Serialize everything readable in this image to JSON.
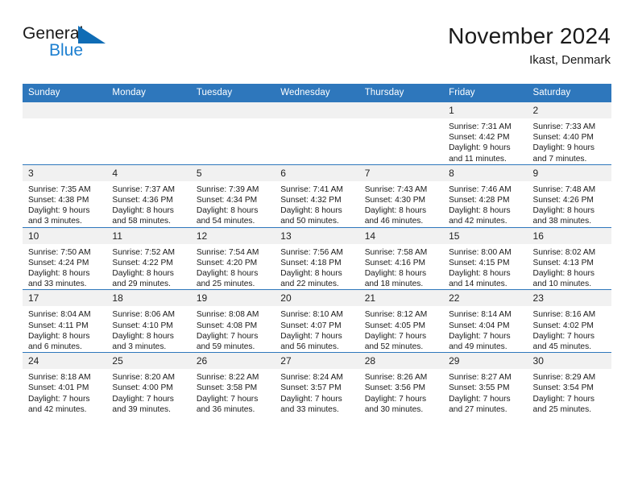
{
  "brand": {
    "name_part1": "General",
    "name_part2": "Blue",
    "triangle_color": "#0f6cb5",
    "blue_color": "#1c7fd0"
  },
  "header": {
    "title": "November 2024",
    "subtitle": "Ikast, Denmark"
  },
  "theme": {
    "header_blue": "#2e77bc",
    "daynum_band": "#f1f1f1",
    "text": "#1a1a1a"
  },
  "weekday_headers": [
    "Sunday",
    "Monday",
    "Tuesday",
    "Wednesday",
    "Thursday",
    "Friday",
    "Saturday"
  ],
  "labels": {
    "sunrise_prefix": "Sunrise:",
    "sunset_prefix": "Sunset:",
    "daylight_prefix": "Daylight:"
  },
  "weeks": [
    [
      {
        "day": "",
        "empty": true
      },
      {
        "day": "",
        "empty": true
      },
      {
        "day": "",
        "empty": true
      },
      {
        "day": "",
        "empty": true
      },
      {
        "day": "",
        "empty": true
      },
      {
        "day": "1",
        "sunrise": "Sunrise: 7:31 AM",
        "sunset": "Sunset: 4:42 PM",
        "daylight_line1": "Daylight: 9 hours",
        "daylight_line2": "and 11 minutes."
      },
      {
        "day": "2",
        "sunrise": "Sunrise: 7:33 AM",
        "sunset": "Sunset: 4:40 PM",
        "daylight_line1": "Daylight: 9 hours",
        "daylight_line2": "and 7 minutes."
      }
    ],
    [
      {
        "day": "3",
        "sunrise": "Sunrise: 7:35 AM",
        "sunset": "Sunset: 4:38 PM",
        "daylight_line1": "Daylight: 9 hours",
        "daylight_line2": "and 3 minutes."
      },
      {
        "day": "4",
        "sunrise": "Sunrise: 7:37 AM",
        "sunset": "Sunset: 4:36 PM",
        "daylight_line1": "Daylight: 8 hours",
        "daylight_line2": "and 58 minutes."
      },
      {
        "day": "5",
        "sunrise": "Sunrise: 7:39 AM",
        "sunset": "Sunset: 4:34 PM",
        "daylight_line1": "Daylight: 8 hours",
        "daylight_line2": "and 54 minutes."
      },
      {
        "day": "6",
        "sunrise": "Sunrise: 7:41 AM",
        "sunset": "Sunset: 4:32 PM",
        "daylight_line1": "Daylight: 8 hours",
        "daylight_line2": "and 50 minutes."
      },
      {
        "day": "7",
        "sunrise": "Sunrise: 7:43 AM",
        "sunset": "Sunset: 4:30 PM",
        "daylight_line1": "Daylight: 8 hours",
        "daylight_line2": "and 46 minutes."
      },
      {
        "day": "8",
        "sunrise": "Sunrise: 7:46 AM",
        "sunset": "Sunset: 4:28 PM",
        "daylight_line1": "Daylight: 8 hours",
        "daylight_line2": "and 42 minutes."
      },
      {
        "day": "9",
        "sunrise": "Sunrise: 7:48 AM",
        "sunset": "Sunset: 4:26 PM",
        "daylight_line1": "Daylight: 8 hours",
        "daylight_line2": "and 38 minutes."
      }
    ],
    [
      {
        "day": "10",
        "sunrise": "Sunrise: 7:50 AM",
        "sunset": "Sunset: 4:24 PM",
        "daylight_line1": "Daylight: 8 hours",
        "daylight_line2": "and 33 minutes."
      },
      {
        "day": "11",
        "sunrise": "Sunrise: 7:52 AM",
        "sunset": "Sunset: 4:22 PM",
        "daylight_line1": "Daylight: 8 hours",
        "daylight_line2": "and 29 minutes."
      },
      {
        "day": "12",
        "sunrise": "Sunrise: 7:54 AM",
        "sunset": "Sunset: 4:20 PM",
        "daylight_line1": "Daylight: 8 hours",
        "daylight_line2": "and 25 minutes."
      },
      {
        "day": "13",
        "sunrise": "Sunrise: 7:56 AM",
        "sunset": "Sunset: 4:18 PM",
        "daylight_line1": "Daylight: 8 hours",
        "daylight_line2": "and 22 minutes."
      },
      {
        "day": "14",
        "sunrise": "Sunrise: 7:58 AM",
        "sunset": "Sunset: 4:16 PM",
        "daylight_line1": "Daylight: 8 hours",
        "daylight_line2": "and 18 minutes."
      },
      {
        "day": "15",
        "sunrise": "Sunrise: 8:00 AM",
        "sunset": "Sunset: 4:15 PM",
        "daylight_line1": "Daylight: 8 hours",
        "daylight_line2": "and 14 minutes."
      },
      {
        "day": "16",
        "sunrise": "Sunrise: 8:02 AM",
        "sunset": "Sunset: 4:13 PM",
        "daylight_line1": "Daylight: 8 hours",
        "daylight_line2": "and 10 minutes."
      }
    ],
    [
      {
        "day": "17",
        "sunrise": "Sunrise: 8:04 AM",
        "sunset": "Sunset: 4:11 PM",
        "daylight_line1": "Daylight: 8 hours",
        "daylight_line2": "and 6 minutes."
      },
      {
        "day": "18",
        "sunrise": "Sunrise: 8:06 AM",
        "sunset": "Sunset: 4:10 PM",
        "daylight_line1": "Daylight: 8 hours",
        "daylight_line2": "and 3 minutes."
      },
      {
        "day": "19",
        "sunrise": "Sunrise: 8:08 AM",
        "sunset": "Sunset: 4:08 PM",
        "daylight_line1": "Daylight: 7 hours",
        "daylight_line2": "and 59 minutes."
      },
      {
        "day": "20",
        "sunrise": "Sunrise: 8:10 AM",
        "sunset": "Sunset: 4:07 PM",
        "daylight_line1": "Daylight: 7 hours",
        "daylight_line2": "and 56 minutes."
      },
      {
        "day": "21",
        "sunrise": "Sunrise: 8:12 AM",
        "sunset": "Sunset: 4:05 PM",
        "daylight_line1": "Daylight: 7 hours",
        "daylight_line2": "and 52 minutes."
      },
      {
        "day": "22",
        "sunrise": "Sunrise: 8:14 AM",
        "sunset": "Sunset: 4:04 PM",
        "daylight_line1": "Daylight: 7 hours",
        "daylight_line2": "and 49 minutes."
      },
      {
        "day": "23",
        "sunrise": "Sunrise: 8:16 AM",
        "sunset": "Sunset: 4:02 PM",
        "daylight_line1": "Daylight: 7 hours",
        "daylight_line2": "and 45 minutes."
      }
    ],
    [
      {
        "day": "24",
        "sunrise": "Sunrise: 8:18 AM",
        "sunset": "Sunset: 4:01 PM",
        "daylight_line1": "Daylight: 7 hours",
        "daylight_line2": "and 42 minutes."
      },
      {
        "day": "25",
        "sunrise": "Sunrise: 8:20 AM",
        "sunset": "Sunset: 4:00 PM",
        "daylight_line1": "Daylight: 7 hours",
        "daylight_line2": "and 39 minutes."
      },
      {
        "day": "26",
        "sunrise": "Sunrise: 8:22 AM",
        "sunset": "Sunset: 3:58 PM",
        "daylight_line1": "Daylight: 7 hours",
        "daylight_line2": "and 36 minutes."
      },
      {
        "day": "27",
        "sunrise": "Sunrise: 8:24 AM",
        "sunset": "Sunset: 3:57 PM",
        "daylight_line1": "Daylight: 7 hours",
        "daylight_line2": "and 33 minutes."
      },
      {
        "day": "28",
        "sunrise": "Sunrise: 8:26 AM",
        "sunset": "Sunset: 3:56 PM",
        "daylight_line1": "Daylight: 7 hours",
        "daylight_line2": "and 30 minutes."
      },
      {
        "day": "29",
        "sunrise": "Sunrise: 8:27 AM",
        "sunset": "Sunset: 3:55 PM",
        "daylight_line1": "Daylight: 7 hours",
        "daylight_line2": "and 27 minutes."
      },
      {
        "day": "30",
        "sunrise": "Sunrise: 8:29 AM",
        "sunset": "Sunset: 3:54 PM",
        "daylight_line1": "Daylight: 7 hours",
        "daylight_line2": "and 25 minutes."
      }
    ]
  ]
}
